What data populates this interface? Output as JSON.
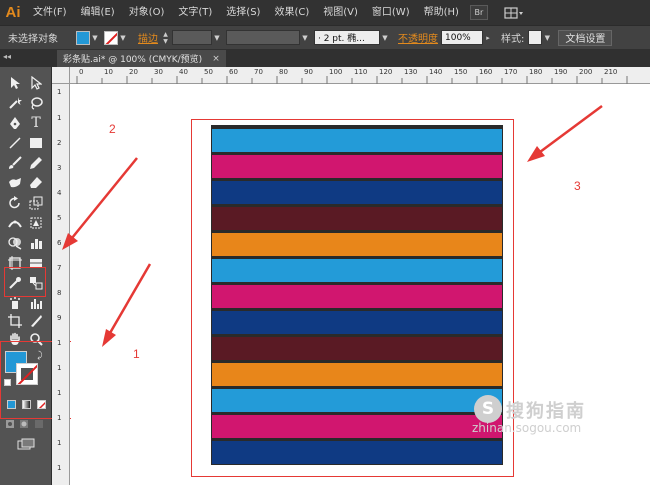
{
  "app": {
    "logo": "Ai"
  },
  "menu": [
    "文件(F)",
    "编辑(E)",
    "对象(O)",
    "文字(T)",
    "选择(S)",
    "效果(C)",
    "视图(V)",
    "窗口(W)",
    "帮助(H)"
  ],
  "menu_buttons": {
    "bridge": "Br"
  },
  "controlbar": {
    "selection_status": "未选择对象",
    "fill_color": "#2398d6",
    "stroke_label": "描边",
    "brush_value": "·  2 pt. 椭...",
    "opacity_label": "不透明度",
    "opacity_value": "100%",
    "style_label": "样式:",
    "doc_setup_button": "文档设置"
  },
  "document_tab": {
    "title": "彩条贴.ai* @ 100% (CMYK/预览)",
    "close": "×"
  },
  "rulers": {
    "top": [
      "0",
      "10",
      "20",
      "30",
      "40",
      "50",
      "60",
      "70",
      "80",
      "90",
      "100",
      "110",
      "120",
      "130",
      "140",
      "150",
      "160",
      "170",
      "180",
      "190",
      "200",
      "210"
    ],
    "left": [
      "1",
      "1",
      "2",
      "3",
      "4",
      "5",
      "6",
      "7",
      "8",
      "9",
      "1",
      "1",
      "1",
      "1",
      "1",
      "1"
    ]
  },
  "artwork": {
    "stripe_colors": [
      "#239bd8",
      "#d1166f",
      "#0f3a83",
      "#5a1a24",
      "#e8861a",
      "#239bd8",
      "#d1166f",
      "#0f3a83",
      "#5a1a24",
      "#e8861a",
      "#239bd8",
      "#d1166f",
      "#0f3a83"
    ]
  },
  "annotations": {
    "label_1": "1",
    "label_2": "2",
    "label_3": "3",
    "color": "#e53935"
  },
  "watermark": {
    "text": "搜狗指南",
    "url": "zhinan.sogou.com",
    "logo_letter": "S"
  }
}
